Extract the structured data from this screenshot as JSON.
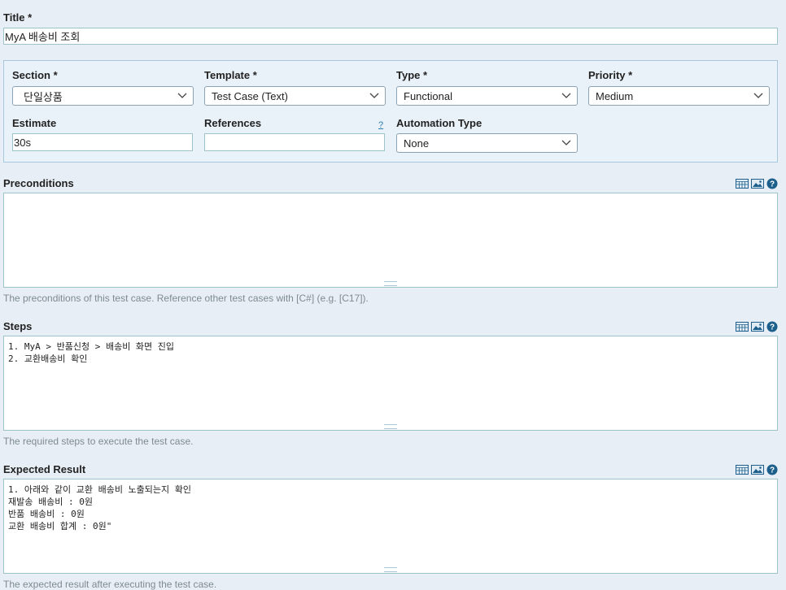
{
  "title_field": {
    "label": "Title *",
    "value": "MyA 배송비 조회"
  },
  "section": {
    "label": "Section *",
    "value": "단일상품"
  },
  "template": {
    "label": "Template *",
    "value": "Test Case (Text)"
  },
  "type": {
    "label": "Type *",
    "value": "Functional"
  },
  "priority": {
    "label": "Priority *",
    "value": "Medium"
  },
  "estimate": {
    "label": "Estimate",
    "value": "30s"
  },
  "references": {
    "label": "References",
    "value": "",
    "help": "?"
  },
  "automation_type": {
    "label": "Automation Type",
    "value": "None"
  },
  "preconditions": {
    "label": "Preconditions",
    "value": "",
    "hint": "The preconditions of this test case. Reference other test cases with [C#] (e.g. [C17])."
  },
  "steps": {
    "label": "Steps",
    "value": "1. MyA > 반품신청 > 배송비 화면 진입\n2. 교환배송비 확인",
    "hint": "The required steps to execute the test case."
  },
  "expected_result": {
    "label": "Expected Result",
    "value": "1. 아래와 같이 교환 배송비 노출되는지 확인\n재발송 배송비 : 0원\n반품 배송비 : 0원\n교환 배송비 합계 : 0원\"",
    "hint": "The expected result after executing the test case."
  },
  "icons": [
    "table-icon",
    "image-icon",
    "help-icon"
  ],
  "colors": {
    "background": "#e7eef5",
    "panel": "#eaf2f9",
    "input_border": "#9ec4c9",
    "help_icon": "#1c5f8c"
  }
}
